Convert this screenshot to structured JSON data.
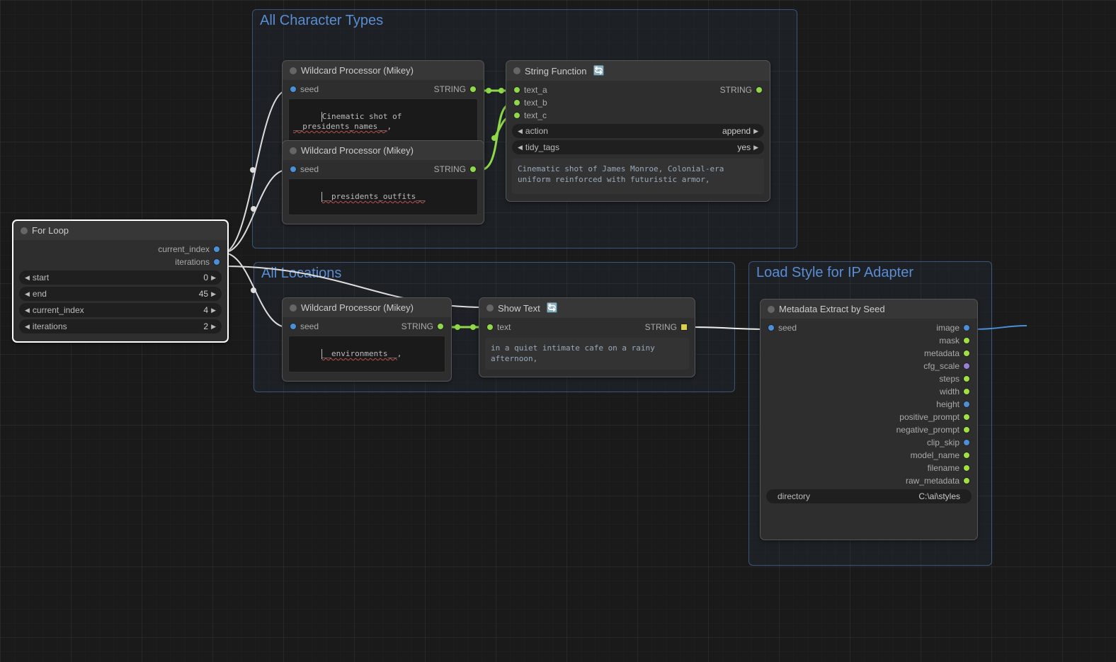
{
  "groups": {
    "chartypes": {
      "title": "All Character Types"
    },
    "locations": {
      "title": "All Locations"
    },
    "loadstyle": {
      "title": "Load Style for IP Adapter"
    }
  },
  "nodes": {
    "forloop": {
      "title": "For Loop",
      "outputs": {
        "current_index": "current_index",
        "iterations": "iterations"
      },
      "widgets": {
        "start": {
          "label": "start",
          "value": "0"
        },
        "end": {
          "label": "end",
          "value": "45"
        },
        "current_index": {
          "label": "current_index",
          "value": "4"
        },
        "iterations": {
          "label": "iterations",
          "value": "2"
        }
      }
    },
    "wildcard1": {
      "title": "Wildcard Processor (Mikey)",
      "inputs": {
        "seed": "seed"
      },
      "outputs": {
        "string": "STRING"
      },
      "text_prefix": "Cinematic shot of ",
      "text_wild": "__presidents_names__",
      "text_suffix": ","
    },
    "wildcard2": {
      "title": "Wildcard Processor (Mikey)",
      "inputs": {
        "seed": "seed"
      },
      "outputs": {
        "string": "STRING"
      },
      "text_wild": "__presidents_outfits__"
    },
    "wildcard3": {
      "title": "Wildcard Processor (Mikey)",
      "inputs": {
        "seed": "seed"
      },
      "outputs": {
        "string": "STRING"
      },
      "text_wild": "__environments__",
      "text_suffix": ","
    },
    "stringfn": {
      "title": "String Function",
      "inputs": {
        "text_a": "text_a",
        "text_b": "text_b",
        "text_c": "text_c"
      },
      "outputs": {
        "string": "STRING"
      },
      "widgets": {
        "action": {
          "label": "action",
          "value": "append"
        },
        "tidy_tags": {
          "label": "tidy_tags",
          "value": "yes"
        }
      },
      "preview": "Cinematic shot of James Monroe, Colonial-era uniform reinforced with futuristic armor,"
    },
    "showtext": {
      "title": "Show Text",
      "inputs": {
        "text": "text"
      },
      "outputs": {
        "string": "STRING"
      },
      "preview": "in a quiet intimate cafe on a rainy afternoon,"
    },
    "metadata": {
      "title": "Metadata Extract by Seed",
      "inputs": {
        "seed": "seed"
      },
      "outputs": {
        "image": "image",
        "mask": "mask",
        "metadata": "metadata",
        "cfg_scale": "cfg_scale",
        "steps": "steps",
        "width": "width",
        "height": "height",
        "positive_prompt": "positive_prompt",
        "negative_prompt": "negative_prompt",
        "clip_skip": "clip_skip",
        "model_name": "model_name",
        "filename": "filename",
        "raw_metadata": "raw_metadata"
      },
      "widgets": {
        "directory": {
          "label": "directory",
          "value": "C:\\ai\\styles"
        }
      }
    }
  }
}
